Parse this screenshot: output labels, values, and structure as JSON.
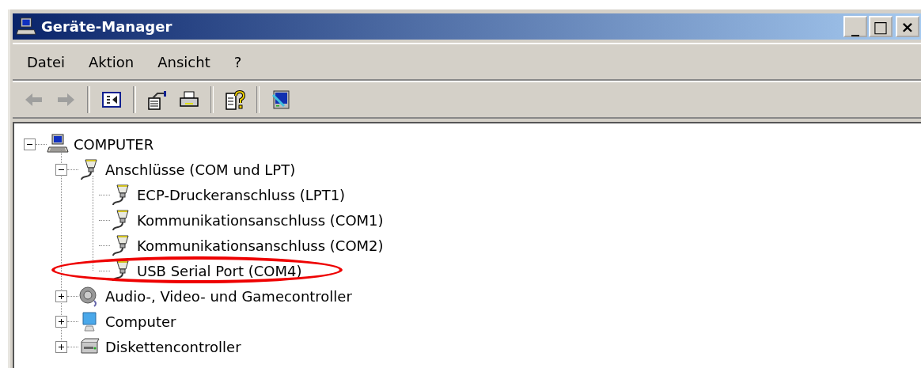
{
  "window": {
    "title": "Geräte-Manager",
    "controls": [
      {
        "kind": "minimize",
        "label": "_"
      },
      {
        "kind": "maximize",
        "label": "□"
      },
      {
        "kind": "close",
        "label": "×"
      }
    ]
  },
  "menu": [
    {
      "label": "Datei"
    },
    {
      "label": "Aktion"
    },
    {
      "label": "Ansicht"
    },
    {
      "label": "?"
    }
  ],
  "toolbar": [
    {
      "kind": "back",
      "disabled": true
    },
    {
      "kind": "forward",
      "disabled": true
    },
    {
      "kind": "separator"
    },
    {
      "kind": "tree-toggle"
    },
    {
      "kind": "separator"
    },
    {
      "kind": "properties"
    },
    {
      "kind": "print"
    },
    {
      "kind": "separator"
    },
    {
      "kind": "help"
    },
    {
      "kind": "separator"
    },
    {
      "kind": "scan"
    }
  ],
  "tree": [
    {
      "label": "COMPUTER",
      "kind": "computer",
      "expanded": true,
      "children": [
        {
          "label": "Anschlüsse (COM und LPT)",
          "kind": "port",
          "expanded": true,
          "children": [
            {
              "label": "ECP-Druckeranschluss (LPT1)",
              "kind": "port",
              "highlighted": false
            },
            {
              "label": "Kommunikationsanschluss (COM1)",
              "kind": "port",
              "highlighted": false
            },
            {
              "label": "Kommunikationsanschluss (COM2)",
              "kind": "port",
              "highlighted": false
            },
            {
              "label": "USB Serial Port (COM4)",
              "kind": "port",
              "highlighted": true
            }
          ]
        },
        {
          "label": "Audio-, Video- und Gamecontroller",
          "kind": "audio",
          "expanded": false
        },
        {
          "label": "Computer",
          "kind": "monitor",
          "expanded": false
        },
        {
          "label": "Diskettencontroller",
          "kind": "floppy",
          "expanded": false
        }
      ]
    }
  ]
}
